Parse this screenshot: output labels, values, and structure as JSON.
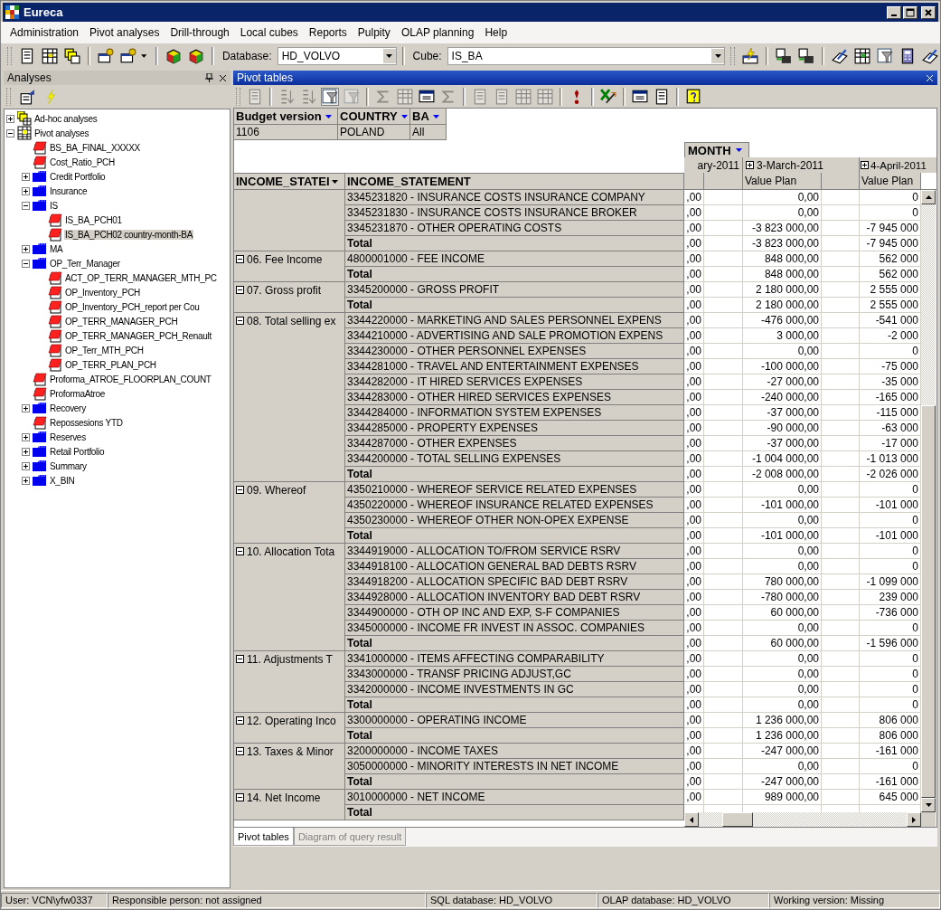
{
  "window": {
    "title": "Eureca"
  },
  "menu": [
    "Administration",
    "Pivot analyses",
    "Drill-through",
    "Local cubes",
    "Reports",
    "Pulpity",
    "OLAP planning",
    "Help"
  ],
  "toolbar": {
    "database_label": "Database:",
    "database": "HD_VOLVO",
    "cube_label": "Cube:",
    "cube": "IS_BA"
  },
  "analyses_panel": {
    "title": "Analyses",
    "tree": [
      {
        "label": "Ad-hoc analyses",
        "kind": "adhoc",
        "expanded": false,
        "selected": false
      },
      {
        "label": "Pivot analyses",
        "kind": "pivot",
        "expanded": true,
        "selected": false,
        "children": [
          {
            "label": "BS_BA_FINAL_XXXXX",
            "kind": "report",
            "selected": false
          },
          {
            "label": "Cost_Ratio_PCH",
            "kind": "report",
            "selected": false
          },
          {
            "label": "Credit Portfolio",
            "kind": "folder",
            "expanded": false,
            "selected": false
          },
          {
            "label": "Insurance",
            "kind": "folder",
            "expanded": false,
            "selected": false
          },
          {
            "label": "IS",
            "kind": "folder",
            "expanded": true,
            "selected": false,
            "children": [
              {
                "label": "IS_BA_PCH01",
                "kind": "report",
                "selected": false
              },
              {
                "label": "IS_BA_PCH02 country-month-BA",
                "kind": "report",
                "selected": true
              }
            ]
          },
          {
            "label": "MA",
            "kind": "folder",
            "expanded": false,
            "selected": false
          },
          {
            "label": "OP_Terr_Manager",
            "kind": "folder",
            "expanded": true,
            "selected": false,
            "children": [
              {
                "label": "ACT_OP_TERR_MANAGER_MTH_PC",
                "kind": "report",
                "selected": false
              },
              {
                "label": "OP_Inventory_PCH",
                "kind": "report",
                "selected": false
              },
              {
                "label": "OP_Inventory_PCH_report per Cou",
                "kind": "report",
                "selected": false
              },
              {
                "label": "OP_TERR_MANAGER_PCH",
                "kind": "report",
                "selected": false
              },
              {
                "label": "OP_TERR_MANAGER_PCH_Renault",
                "kind": "report",
                "selected": false
              },
              {
                "label": "OP_Terr_MTH_PCH",
                "kind": "report",
                "selected": false
              },
              {
                "label": "OP_TERR_PLAN_PCH",
                "kind": "report",
                "selected": false
              }
            ]
          },
          {
            "label": "Proforma_ATROE_FLOORPLAN_COUNT",
            "kind": "report",
            "selected": false
          },
          {
            "label": "ProformaAtroe",
            "kind": "report",
            "selected": false
          },
          {
            "label": "Recovery",
            "kind": "folder",
            "expanded": false,
            "selected": false
          },
          {
            "label": "Repossesions YTD",
            "kind": "report",
            "selected": false
          },
          {
            "label": "Reserves",
            "kind": "folder",
            "expanded": false,
            "selected": false
          },
          {
            "label": "Retail Portfolio",
            "kind": "folder",
            "expanded": false,
            "selected": false
          },
          {
            "label": "Summary",
            "kind": "folder",
            "expanded": false,
            "selected": false
          },
          {
            "label": "X_BIN",
            "kind": "folder",
            "expanded": false,
            "selected": false
          }
        ]
      }
    ]
  },
  "pivot_panel": {
    "title": "Pivot tables",
    "filters": [
      {
        "name": "Budget version",
        "value": "1106"
      },
      {
        "name": "COUNTRY",
        "value": "POLAND"
      },
      {
        "name": "BA",
        "value": "All"
      }
    ],
    "column_dimension": "MONTH",
    "cut_month": "ary-2011",
    "months": [
      {
        "label": "3-March-2011",
        "expanded": false
      },
      {
        "label": "4-April-2011",
        "expanded": false
      }
    ],
    "measures": [
      "Value Plan",
      "Value Plan"
    ],
    "row_headers": [
      "INCOME_STATEI",
      "INCOME_STATEMENT"
    ],
    "groups": [
      {
        "rows": [
          {
            "account": "3345231820 - INSURANCE COSTS INSURANCE COMPANY",
            "kind": "account",
            "values": [
              ",00",
              "0,00",
              "0"
            ]
          },
          {
            "account": "3345231830 - INSURANCE COSTS INSURANCE BROKER",
            "kind": "account",
            "values": [
              ",00",
              "0,00",
              "0"
            ]
          },
          {
            "account": "3345231870 - OTHER OPERATING COSTS",
            "kind": "account",
            "values": [
              ",00",
              "-3 823 000,00",
              "-7 945 000"
            ]
          },
          {
            "account": "Total",
            "kind": "total",
            "values": [
              ",00",
              "-3 823 000,00",
              "-7 945 000"
            ]
          }
        ]
      },
      {
        "label": "06. Fee Income",
        "expanded": true,
        "rows": [
          {
            "account": "4800001000 - FEE INCOME",
            "kind": "account",
            "values": [
              ",00",
              "848 000,00",
              "562 000"
            ]
          },
          {
            "account": "Total",
            "kind": "total",
            "values": [
              ",00",
              "848 000,00",
              "562 000"
            ]
          }
        ]
      },
      {
        "label": "07. Gross profit",
        "expanded": true,
        "rows": [
          {
            "account": "3345200000 - GROSS PROFIT",
            "kind": "account",
            "values": [
              ",00",
              "2 180 000,00",
              "2 555 000"
            ]
          },
          {
            "account": "Total",
            "kind": "total",
            "values": [
              ",00",
              "2 180 000,00",
              "2 555 000"
            ]
          }
        ]
      },
      {
        "label": "08. Total selling ex",
        "expanded": true,
        "rows": [
          {
            "account": "3344220000 - MARKETING AND SALES PERSONNEL EXPENS",
            "kind": "account",
            "values": [
              ",00",
              "-476 000,00",
              "-541 000"
            ]
          },
          {
            "account": "3344210000 - ADVERTISING AND SALE PROMOTION EXPENS",
            "kind": "account",
            "values": [
              ",00",
              "3 000,00",
              "-2 000"
            ]
          },
          {
            "account": "3344230000 - OTHER PERSONNEL EXPENSES",
            "kind": "account",
            "values": [
              ",00",
              "0,00",
              "0"
            ]
          },
          {
            "account": "3344281000 - TRAVEL AND ENTERTAINMENT EXPENSES",
            "kind": "account",
            "values": [
              ",00",
              "-100 000,00",
              "-75 000"
            ]
          },
          {
            "account": "3344282000 - IT HIRED SERVICES EXPENSES",
            "kind": "account",
            "values": [
              ",00",
              "-27 000,00",
              "-35 000"
            ]
          },
          {
            "account": "3344283000 - OTHER HIRED SERVICES EXPENSES",
            "kind": "account",
            "values": [
              ",00",
              "-240 000,00",
              "-165 000"
            ]
          },
          {
            "account": "3344284000 - INFORMATION SYSTEM EXPENSES",
            "kind": "account",
            "values": [
              ",00",
              "-37 000,00",
              "-115 000"
            ]
          },
          {
            "account": "3344285000 - PROPERTY EXPENSES",
            "kind": "account",
            "values": [
              ",00",
              "-90 000,00",
              "-63 000"
            ]
          },
          {
            "account": "3344287000 - OTHER EXPENSES",
            "kind": "account",
            "values": [
              ",00",
              "-37 000,00",
              "-17 000"
            ]
          },
          {
            "account": "3344200000 - TOTAL SELLING EXPENSES",
            "kind": "account",
            "values": [
              ",00",
              "-1 004 000,00",
              "-1 013 000"
            ]
          },
          {
            "account": "Total",
            "kind": "total",
            "values": [
              ",00",
              "-2 008 000,00",
              "-2 026 000"
            ]
          }
        ]
      },
      {
        "label": "09. Whereof",
        "expanded": true,
        "rows": [
          {
            "account": "4350210000 - WHEREOF SERVICE RELATED EXPENSES",
            "kind": "account",
            "values": [
              ",00",
              "0,00",
              "0"
            ]
          },
          {
            "account": "4350220000 - WHEREOF INSURANCE RELATED EXPENSES",
            "kind": "account",
            "values": [
              ",00",
              "-101 000,00",
              "-101 000"
            ]
          },
          {
            "account": "4350230000 - WHEREOF OTHER NON-OPEX EXPENSE",
            "kind": "account",
            "values": [
              ",00",
              "0,00",
              "0"
            ]
          },
          {
            "account": "Total",
            "kind": "total",
            "values": [
              ",00",
              "-101 000,00",
              "-101 000"
            ]
          }
        ]
      },
      {
        "label": "10. Allocation Tota",
        "expanded": true,
        "rows": [
          {
            "account": "3344919000 - ALLOCATION TO/FROM SERVICE RSRV",
            "kind": "account",
            "values": [
              ",00",
              "0,00",
              "0"
            ]
          },
          {
            "account": "3344918100 - ALLOCATION GENERAL BAD DEBTS RSRV",
            "kind": "account",
            "values": [
              ",00",
              "0,00",
              "0"
            ]
          },
          {
            "account": "3344918200 - ALLOCATION SPECIFIC BAD DEBT RSRV",
            "kind": "account",
            "values": [
              ",00",
              "780 000,00",
              "-1 099 000"
            ]
          },
          {
            "account": "3344928000 - ALLOCATION INVENTORY BAD DEBT RSRV",
            "kind": "account",
            "values": [
              ",00",
              "-780 000,00",
              "239 000"
            ]
          },
          {
            "account": "3344900000 - OTH OP INC AND EXP, S-F COMPANIES",
            "kind": "account",
            "values": [
              ",00",
              "60 000,00",
              "-736 000"
            ]
          },
          {
            "account": "3345000000 - INCOME FR INVEST IN ASSOC. COMPANIES",
            "kind": "account",
            "values": [
              ",00",
              "0,00",
              "0"
            ]
          },
          {
            "account": "Total",
            "kind": "total",
            "values": [
              ",00",
              "60 000,00",
              "-1 596 000"
            ]
          }
        ]
      },
      {
        "label": "11. Adjustments T",
        "expanded": true,
        "rows": [
          {
            "account": "3341000000 - ITEMS AFFECTING COMPARABILITY",
            "kind": "account",
            "values": [
              ",00",
              "0,00",
              "0"
            ]
          },
          {
            "account": "3343000000 - TRANSF PRICING ADJUST,GC",
            "kind": "account",
            "values": [
              ",00",
              "0,00",
              "0"
            ]
          },
          {
            "account": "3342000000 - INCOME INVESTMENTS IN GC",
            "kind": "account",
            "values": [
              ",00",
              "0,00",
              "0"
            ]
          },
          {
            "account": "Total",
            "kind": "total",
            "values": [
              ",00",
              "0,00",
              "0"
            ]
          }
        ]
      },
      {
        "label": "12. Operating Inco",
        "expanded": true,
        "rows": [
          {
            "account": "3300000000 - OPERATING INCOME",
            "kind": "account",
            "values": [
              ",00",
              "1 236 000,00",
              "806 000"
            ]
          },
          {
            "account": "Total",
            "kind": "total",
            "values": [
              ",00",
              "1 236 000,00",
              "806 000"
            ]
          }
        ]
      },
      {
        "label": "13. Taxes & Minor",
        "expanded": true,
        "rows": [
          {
            "account": "3200000000 - INCOME TAXES",
            "kind": "account",
            "values": [
              ",00",
              "-247 000,00",
              "-161 000"
            ]
          },
          {
            "account": "3050000000 - MINORITY INTERESTS IN NET INCOME",
            "kind": "account",
            "values": [
              ",00",
              "0,00",
              "0"
            ]
          },
          {
            "account": "Total",
            "kind": "total",
            "values": [
              ",00",
              "-247 000,00",
              "-161 000"
            ]
          }
        ]
      },
      {
        "label": "14. Net Income",
        "expanded": true,
        "rows": [
          {
            "account": "3010000000 - NET INCOME",
            "kind": "account",
            "values": [
              ",00",
              "989 000,00",
              "645 000"
            ]
          },
          {
            "account": "Total",
            "kind": "total"
          }
        ]
      }
    ]
  },
  "tabs": [
    {
      "label": "Pivot tables",
      "selected": true
    },
    {
      "label": "Diagram of query result",
      "selected": false
    }
  ],
  "status_bar": [
    "User: VCN\\yfw0337",
    "Responsible person: not assigned",
    "SQL database: HD_VOLVO",
    "OLAP database: HD_VOLVO",
    "Working version: Missing"
  ]
}
